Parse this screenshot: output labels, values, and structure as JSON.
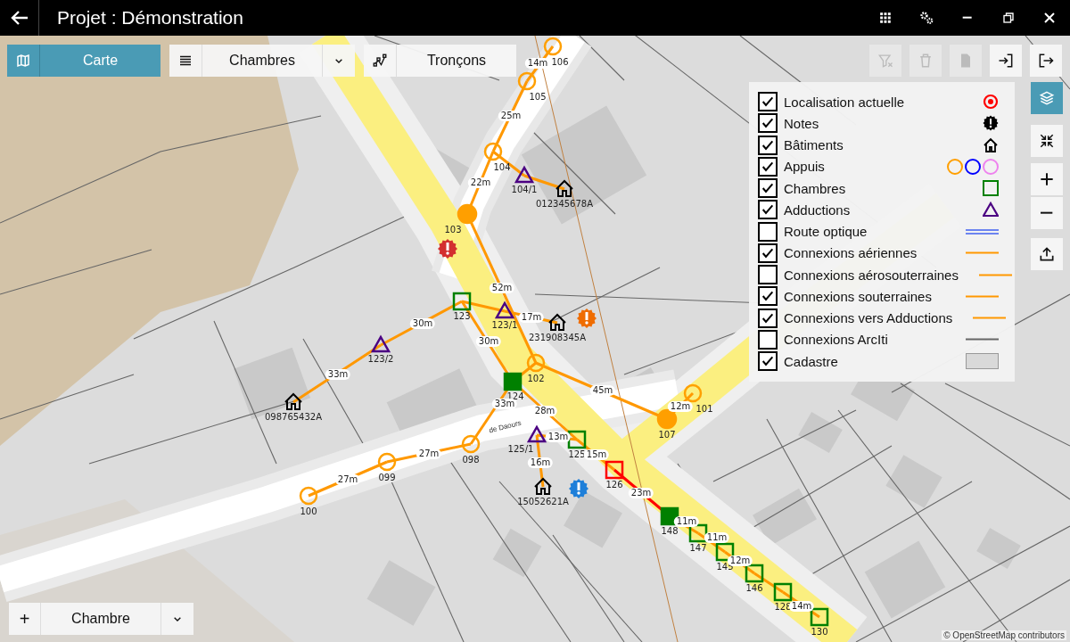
{
  "window": {
    "title": "Projet : Démonstration"
  },
  "toolbar": {
    "mode_tab": {
      "label": "Carte",
      "selected": true
    },
    "layer_select": {
      "value": "Chambres"
    },
    "sections_button": {
      "label": "Tronçons"
    },
    "actions": [
      {
        "kind": "clear-filter",
        "disabled": true
      },
      {
        "kind": "delete",
        "disabled": true
      },
      {
        "kind": "document",
        "disabled": true
      },
      {
        "kind": "import",
        "disabled": false
      },
      {
        "kind": "exit",
        "disabled": false
      }
    ]
  },
  "side_tools": [
    {
      "kind": "layers",
      "selected": true
    },
    {
      "kind": "fit",
      "selected": false
    },
    {
      "kind": "zoom-in",
      "selected": false
    },
    {
      "kind": "zoom-out",
      "selected": false
    },
    {
      "kind": "upload",
      "selected": false
    }
  ],
  "legend": {
    "items": [
      {
        "label": "Localisation actuelle",
        "checked": true,
        "kind": "location"
      },
      {
        "label": "Notes",
        "checked": true,
        "kind": "note"
      },
      {
        "label": "Bâtiments",
        "checked": true,
        "kind": "building"
      },
      {
        "label": "Appuis",
        "checked": true,
        "kind": "poles"
      },
      {
        "label": "Chambres",
        "checked": true,
        "kind": "chamber"
      },
      {
        "label": "Adductions",
        "checked": true,
        "kind": "adduction"
      },
      {
        "label": "Route optique",
        "checked": false,
        "kind": "double-line"
      },
      {
        "label": "Connexions aériennes",
        "checked": true,
        "kind": "orange-line"
      },
      {
        "label": "Connexions aérosouterraines",
        "checked": false,
        "kind": "orange-line"
      },
      {
        "label": "Connexions souterraines",
        "checked": true,
        "kind": "orange-line"
      },
      {
        "label": "Connexions vers Adductions",
        "checked": true,
        "kind": "orange-line"
      },
      {
        "label": "Connexions ArcIti",
        "checked": false,
        "kind": "grey-line"
      },
      {
        "label": "Cadastre",
        "checked": true,
        "kind": "area"
      }
    ]
  },
  "map": {
    "street": {
      "name": "de Daours"
    },
    "connections": [
      {
        "label": "14m",
        "color": "#ff9800"
      },
      {
        "label": "25m",
        "color": "#ff9800"
      },
      {
        "label": "22m",
        "color": "#ff9800"
      },
      {
        "color": "#ff9800"
      },
      {
        "color": "#ff9800"
      },
      {
        "label": "52m",
        "color": "#ff9800"
      },
      {
        "color": "#ff9800"
      },
      {
        "label": "17m",
        "color": "#ff9800"
      },
      {
        "label": "30m",
        "color": "#ff9800"
      },
      {
        "label": "33m",
        "color": "#ff9800"
      },
      {
        "label": "30m",
        "color": "#ff9800"
      },
      {
        "color": "#ff9800"
      },
      {
        "label": "33m",
        "color": "#ff9800"
      },
      {
        "label": "45m",
        "color": "#ff9800"
      },
      {
        "label": "12m",
        "color": "#ff9800"
      },
      {
        "label": "28m",
        "color": "#ff9800"
      },
      {
        "label": "13m",
        "color": "#ff9800"
      },
      {
        "label": "16m",
        "color": "#ff9800"
      },
      {
        "label": "15m",
        "color": "#ff9800"
      },
      {
        "label": "23m",
        "color": "#ff0000"
      },
      {
        "label": "11m",
        "color": "#ff9800"
      },
      {
        "label": "11m",
        "color": "#ff9800"
      },
      {
        "label": "12m",
        "color": "#ff9800"
      },
      {
        "color": "#ff9800"
      },
      {
        "label": "14m",
        "color": "#ff9800"
      },
      {
        "label": "27m",
        "color": "#ff9800"
      },
      {
        "label": "27m",
        "color": "#ff9800"
      }
    ],
    "poles": [
      {
        "label": "106",
        "filled": false
      },
      {
        "label": "105",
        "filled": false
      },
      {
        "label": "104",
        "filled": false
      },
      {
        "label": "103",
        "filled": true
      },
      {
        "label": "102",
        "filled": false
      },
      {
        "label": "107",
        "filled": true
      },
      {
        "label": "101",
        "filled": false
      },
      {
        "label": "098",
        "filled": false
      },
      {
        "label": "099",
        "filled": false
      },
      {
        "label": "100",
        "filled": false
      }
    ],
    "chambers": [
      {
        "label": "123",
        "filled": false,
        "color": "#008000"
      },
      {
        "label": "124",
        "filled": true,
        "color": "#008000"
      },
      {
        "label": "125",
        "filled": false,
        "color": "#008000"
      },
      {
        "label": "126",
        "filled": false,
        "color": "#ff0000"
      },
      {
        "label": "148",
        "filled": true,
        "color": "#008000"
      },
      {
        "label": "147",
        "filled": false,
        "color": "#008000"
      },
      {
        "label": "145",
        "filled": false,
        "color": "#008000"
      },
      {
        "label": "146",
        "filled": false,
        "color": "#008000"
      },
      {
        "label": "128",
        "filled": false,
        "color": "#008000"
      },
      {
        "label": "130",
        "filled": false,
        "color": "#008000"
      }
    ],
    "adductions": [
      {
        "label": "104/1"
      },
      {
        "label": "123/1"
      },
      {
        "label": "123/2"
      },
      {
        "label": "125/1"
      }
    ],
    "buildings": [
      {
        "label": "012345678A"
      },
      {
        "label": "231908345A"
      },
      {
        "label": "098765432A"
      },
      {
        "label": "15052621A"
      }
    ],
    "notes": [
      {
        "color": "#d32f2f"
      },
      {
        "color": "#ef6c00"
      },
      {
        "color": "#1e7fd9"
      }
    ]
  },
  "bottom_bar": {
    "add_button": "+",
    "type_select": {
      "value": "Chambre"
    }
  },
  "attribution": "© OpenStreetMap contributors"
}
